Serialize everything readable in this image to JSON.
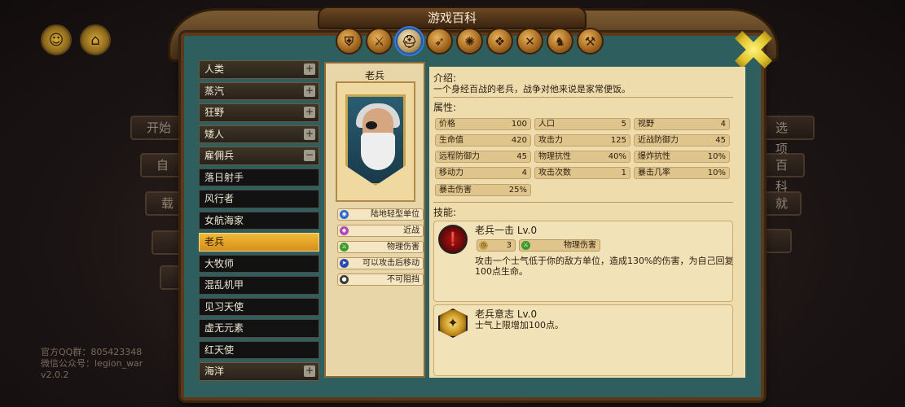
{
  "background": {
    "left_buttons": [
      "开始",
      "自",
      "载",
      "",
      ""
    ],
    "right_buttons": [
      "选项",
      "百科",
      "就",
      ""
    ],
    "footer_lines": [
      "官方QQ群：805423348",
      "微信公众号：legion_war",
      "v2.0.2"
    ]
  },
  "window": {
    "title": "游戏百科",
    "category_tabs": [
      {
        "name": "shield-icon",
        "glyph": "⛨"
      },
      {
        "name": "claw-icon",
        "glyph": "⚔"
      },
      {
        "name": "helmet-icon",
        "glyph": "⛑"
      },
      {
        "name": "wing-icon",
        "glyph": "➶"
      },
      {
        "name": "swirl-icon",
        "glyph": "✺"
      },
      {
        "name": "book-icon",
        "glyph": "❖"
      },
      {
        "name": "crossed-swords-icon",
        "glyph": "✕"
      },
      {
        "name": "knight-helm-icon",
        "glyph": "♞"
      },
      {
        "name": "hammer-icon",
        "glyph": "⚒"
      }
    ],
    "active_tab_index": 2
  },
  "sidebar": {
    "items": [
      {
        "label": "人类",
        "type": "category",
        "toggle": "+"
      },
      {
        "label": "蒸汽",
        "type": "category",
        "toggle": "+"
      },
      {
        "label": "狂野",
        "type": "category",
        "toggle": "+"
      },
      {
        "label": "矮人",
        "type": "category",
        "toggle": "+"
      },
      {
        "label": "雇佣兵",
        "type": "category",
        "toggle": "−"
      },
      {
        "label": "落日射手",
        "type": "unit"
      },
      {
        "label": "风行者",
        "type": "unit"
      },
      {
        "label": "女航海家",
        "type": "unit"
      },
      {
        "label": "老兵",
        "type": "unit",
        "selected": true
      },
      {
        "label": "大牧师",
        "type": "unit"
      },
      {
        "label": "混乱机甲",
        "type": "unit"
      },
      {
        "label": "见习天使",
        "type": "unit"
      },
      {
        "label": "虚无元素",
        "type": "unit"
      },
      {
        "label": "红天使",
        "type": "unit"
      },
      {
        "label": "海洋",
        "type": "category",
        "toggle": "+"
      }
    ]
  },
  "unit": {
    "name": "老兵",
    "tags": [
      {
        "label": "陆地轻型单位",
        "icon": "footprint-icon",
        "color": "#2a6ad0"
      },
      {
        "label": "近战",
        "icon": "melee-icon",
        "color": "#b04ab0"
      },
      {
        "label": "物理伤害",
        "icon": "sword-icon",
        "color": "#3a9a2a"
      },
      {
        "label": "可以攻击后移动",
        "icon": "boot-icon",
        "color": "#2a4ab0"
      },
      {
        "label": "不可阻挡",
        "icon": "unstoppable-icon",
        "color": "#3a3a3a"
      }
    ],
    "intro_label": "介绍:",
    "intro_text": "一个身经百战的老兵，战争对他来说是家常便饭。",
    "attributes_label": "属性:",
    "stats": [
      {
        "label": "价格",
        "value": "100"
      },
      {
        "label": "人口",
        "value": "5"
      },
      {
        "label": "视野",
        "value": "4"
      },
      {
        "label": "生命值",
        "value": "420"
      },
      {
        "label": "攻击力",
        "value": "125"
      },
      {
        "label": "近战防御力",
        "value": "45"
      },
      {
        "label": "远程防御力",
        "value": "45"
      },
      {
        "label": "物理抗性",
        "value": "40%"
      },
      {
        "label": "爆炸抗性",
        "value": "10%"
      },
      {
        "label": "移动力",
        "value": "4"
      },
      {
        "label": "攻击次数",
        "value": "1"
      },
      {
        "label": "暴击几率",
        "value": "10%"
      },
      {
        "label": "暴击伤害",
        "value": "25%"
      }
    ],
    "skills_label": "技能:",
    "skills": [
      {
        "name": "老兵一击 Lv.0",
        "cooldown": "3",
        "damage_type": "物理伤害",
        "desc_line1": "攻击一个士气低于你的敌方单位，造成130%的伤害，为自己回复",
        "desc_line2": "100点生命。"
      },
      {
        "name": "老兵意志 Lv.0",
        "desc_line1": "士气上限增加100点。"
      }
    ]
  }
}
